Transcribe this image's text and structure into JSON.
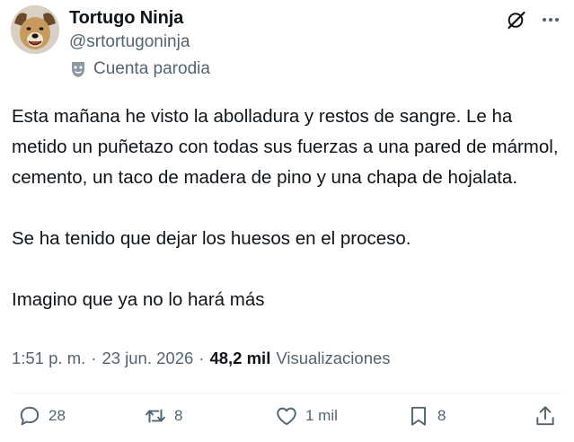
{
  "tweet": {
    "display_name": "Tortugo Ninja",
    "handle": "@srtortugoninja",
    "parody_label": "Cuenta parodia",
    "paragraphs": [
      "Esta mañana he visto la abolladura y restos de sangre. Le ha metido un puñetazo con todas sus fuerzas a una pared de mármol, cemento, un taco de madera de pino y una chapa de hojalata.",
      "Se ha tenido que dejar los huesos en el proceso.",
      "Imagino que ya no lo hará más"
    ],
    "time": "1:51 p. m.",
    "separator": "·",
    "date": "23 jun. 2026",
    "views_count": "48,2 mil",
    "views_label": "Visualizaciones"
  },
  "actions": {
    "replies": "28",
    "retweets": "8",
    "likes": "1 mil",
    "bookmarks": "8"
  },
  "icons": {
    "top": [
      "grok-icon",
      "more-icon"
    ],
    "actions": [
      "reply-icon",
      "retweet-icon",
      "like-icon",
      "bookmark-icon",
      "share-icon"
    ],
    "parody": "parody-mask-icon"
  },
  "colors": {
    "text": "#0f1419",
    "secondary": "#536471",
    "divider": "#eff3f4"
  }
}
